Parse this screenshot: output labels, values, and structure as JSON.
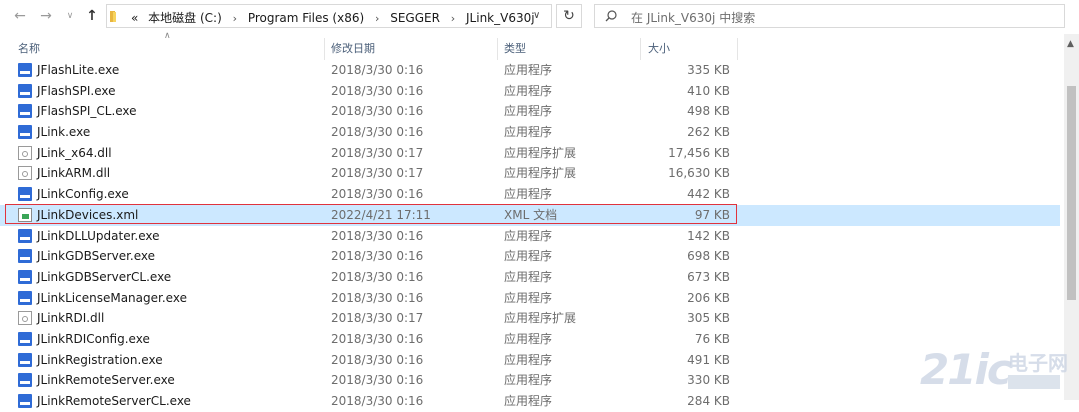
{
  "nav": {
    "back_icon": "arrow-left-icon",
    "forward_icon": "arrow-right-icon",
    "recent_icon": "chevron-down-icon",
    "up_icon": "arrow-up-icon"
  },
  "address": {
    "overflow": "«",
    "crumbs": [
      "本地磁盘 (C:)",
      "Program Files (x86)",
      "SEGGER",
      "JLink_V630j"
    ],
    "separator": "›"
  },
  "search": {
    "placeholder": "在 JLink_V630j 中搜索"
  },
  "columns": {
    "name": "名称",
    "date": "修改日期",
    "type": "类型",
    "size": "大小"
  },
  "files": [
    {
      "name": "JFlashLite.exe",
      "date": "2018/3/30 0:16",
      "type": "应用程序",
      "size": "335 KB",
      "kind": "exe"
    },
    {
      "name": "JFlashSPI.exe",
      "date": "2018/3/30 0:16",
      "type": "应用程序",
      "size": "410 KB",
      "kind": "exe"
    },
    {
      "name": "JFlashSPI_CL.exe",
      "date": "2018/3/30 0:16",
      "type": "应用程序",
      "size": "498 KB",
      "kind": "exe"
    },
    {
      "name": "JLink.exe",
      "date": "2018/3/30 0:16",
      "type": "应用程序",
      "size": "262 KB",
      "kind": "exe"
    },
    {
      "name": "JLink_x64.dll",
      "date": "2018/3/30 0:17",
      "type": "应用程序扩展",
      "size": "17,456 KB",
      "kind": "dll"
    },
    {
      "name": "JLinkARM.dll",
      "date": "2018/3/30 0:17",
      "type": "应用程序扩展",
      "size": "16,630 KB",
      "kind": "dll"
    },
    {
      "name": "JLinkConfig.exe",
      "date": "2018/3/30 0:16",
      "type": "应用程序",
      "size": "442 KB",
      "kind": "exe"
    },
    {
      "name": "JLinkDevices.xml",
      "date": "2022/4/21 17:11",
      "type": "XML 文档",
      "size": "97 KB",
      "kind": "xml",
      "selected": true
    },
    {
      "name": "JLinkDLLUpdater.exe",
      "date": "2018/3/30 0:16",
      "type": "应用程序",
      "size": "142 KB",
      "kind": "exe"
    },
    {
      "name": "JLinkGDBServer.exe",
      "date": "2018/3/30 0:16",
      "type": "应用程序",
      "size": "698 KB",
      "kind": "exe"
    },
    {
      "name": "JLinkGDBServerCL.exe",
      "date": "2018/3/30 0:16",
      "type": "应用程序",
      "size": "673 KB",
      "kind": "exe"
    },
    {
      "name": "JLinkLicenseManager.exe",
      "date": "2018/3/30 0:16",
      "type": "应用程序",
      "size": "206 KB",
      "kind": "exe"
    },
    {
      "name": "JLinkRDI.dll",
      "date": "2018/3/30 0:17",
      "type": "应用程序扩展",
      "size": "305 KB",
      "kind": "dll"
    },
    {
      "name": "JLinkRDIConfig.exe",
      "date": "2018/3/30 0:16",
      "type": "应用程序",
      "size": "76 KB",
      "kind": "exe"
    },
    {
      "name": "JLinkRegistration.exe",
      "date": "2018/3/30 0:16",
      "type": "应用程序",
      "size": "491 KB",
      "kind": "exe"
    },
    {
      "name": "JLinkRemoteServer.exe",
      "date": "2018/3/30 0:16",
      "type": "应用程序",
      "size": "330 KB",
      "kind": "exe"
    },
    {
      "name": "JLinkRemoteServerCL.exe",
      "date": "2018/3/30 0:16",
      "type": "应用程序",
      "size": "284 KB",
      "kind": "exe"
    }
  ],
  "watermark": {
    "text": "21ic",
    "cn": "电子网"
  },
  "colors": {
    "selection": "#cce8ff",
    "highlight_border": "#e0333c",
    "header_text": "#4c607a"
  }
}
